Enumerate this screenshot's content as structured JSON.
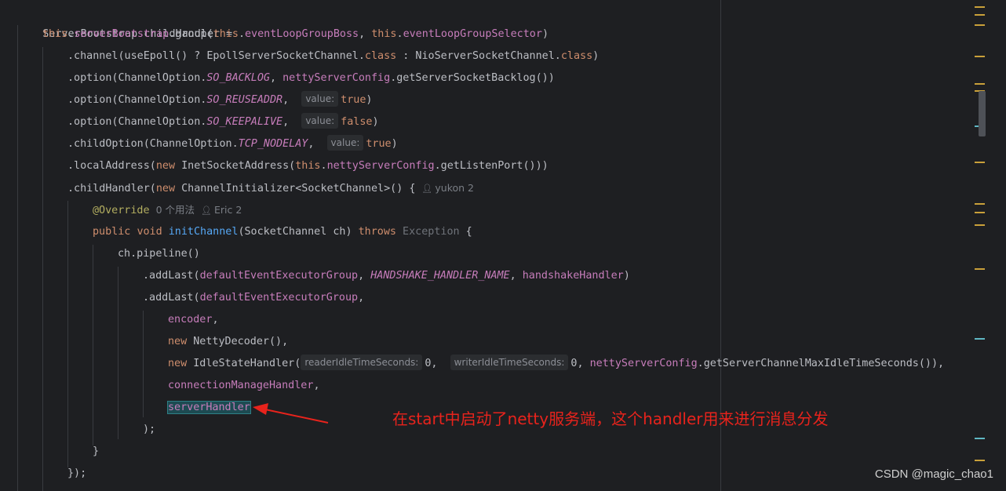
{
  "code": {
    "l1": {
      "a": "ServerBootstrap childHandler ="
    },
    "l2": {
      "this1": "this",
      "dot1": ".",
      "field1": "serverBootstrap",
      "m": ".group(",
      "this2": "this",
      "dot2": ".",
      "field2": "eventLoopGroupBoss",
      "comma": ", ",
      "this3": "this",
      "dot3": ".",
      "field3": "eventLoopGroupSelector",
      "end": ")"
    },
    "l3": {
      "a": ".channel(useEpoll() ? EpollServerSocketChannel.",
      "k1": "class",
      "b": " : NioServerSocketChannel.",
      "k2": "class",
      "c": ")"
    },
    "l4": {
      "a": ".option(ChannelOption.",
      "s": "SO_BACKLOG",
      "b": ", ",
      "f": "nettyServerConfig",
      "c": ".getServerSocketBacklog())"
    },
    "l5": {
      "a": ".option(ChannelOption.",
      "s": "SO_REUSEADDR",
      "b": ",  ",
      "hint": "value:",
      "k": "true",
      "c": ")"
    },
    "l6": {
      "a": ".option(ChannelOption.",
      "s": "SO_KEEPALIVE",
      "b": ",  ",
      "hint": "value:",
      "k": "false",
      "c": ")"
    },
    "l7": {
      "a": ".childOption(ChannelOption.",
      "s": "TCP_NODELAY",
      "b": ",  ",
      "hint": "value:",
      "k": "true",
      "c": ")"
    },
    "l8": {
      "a": ".localAddress(",
      "k": "new",
      "b": " InetSocketAddress(",
      "t": "this",
      "d": ".",
      "f": "nettyServerConfig",
      "c": ".getListenPort()))"
    },
    "l9": {
      "a": ".childHandler(",
      "k": "new",
      "b": " ChannelInitializer<SocketChannel>() {",
      "author": "yukon 2"
    },
    "l10": {
      "anno": "@Override",
      "usages": "0 个用法",
      "author": "Eric 2"
    },
    "l11": {
      "k1": "public",
      "k2": "void",
      "m": "initChannel",
      "a": "(SocketChannel ch) ",
      "k3": "throws",
      "g": " Exception",
      "b": " {"
    },
    "l12": {
      "a": "ch.pipeline()"
    },
    "l13": {
      "a": ".addLast(",
      "f1": "defaultEventExecutorGroup",
      "b": ", ",
      "s": "HANDSHAKE_HANDLER_NAME",
      "c": ", ",
      "f2": "handshakeHandler",
      "d": ")"
    },
    "l14": {
      "a": ".addLast(",
      "f": "defaultEventExecutorGroup",
      "b": ","
    },
    "l15": {
      "f": "encoder",
      "b": ","
    },
    "l16": {
      "k": "new",
      "a": " NettyDecoder(),"
    },
    "l17": {
      "k": "new",
      "a": " IdleStateHandler(",
      "h1": "readerIdleTimeSeconds:",
      "v1": "0",
      "b": ",  ",
      "h2": "writerIdleTimeSeconds:",
      "v2": "0",
      "c": ", ",
      "f": "nettyServerConfig",
      "d": ".getServerChannelMaxIdleTimeSeconds()),"
    },
    "l18": {
      "f": "connectionManageHandler",
      "b": ","
    },
    "l19": {
      "f": "serverHandler"
    },
    "l20": {
      "a": ");"
    },
    "l21": {
      "a": "}"
    },
    "l22": {
      "a": "});"
    }
  },
  "annotation": {
    "text": "在start中启动了netty服务端，这个handler用来进行消息分发",
    "color": "#e8231c"
  },
  "watermark": "CSDN @magic_chao1",
  "colors": {
    "background": "#1e1f22",
    "keyword": "#cf8e6d",
    "field": "#c77dbb",
    "method": "#56a8f5",
    "annotation": "#b3ae60"
  }
}
